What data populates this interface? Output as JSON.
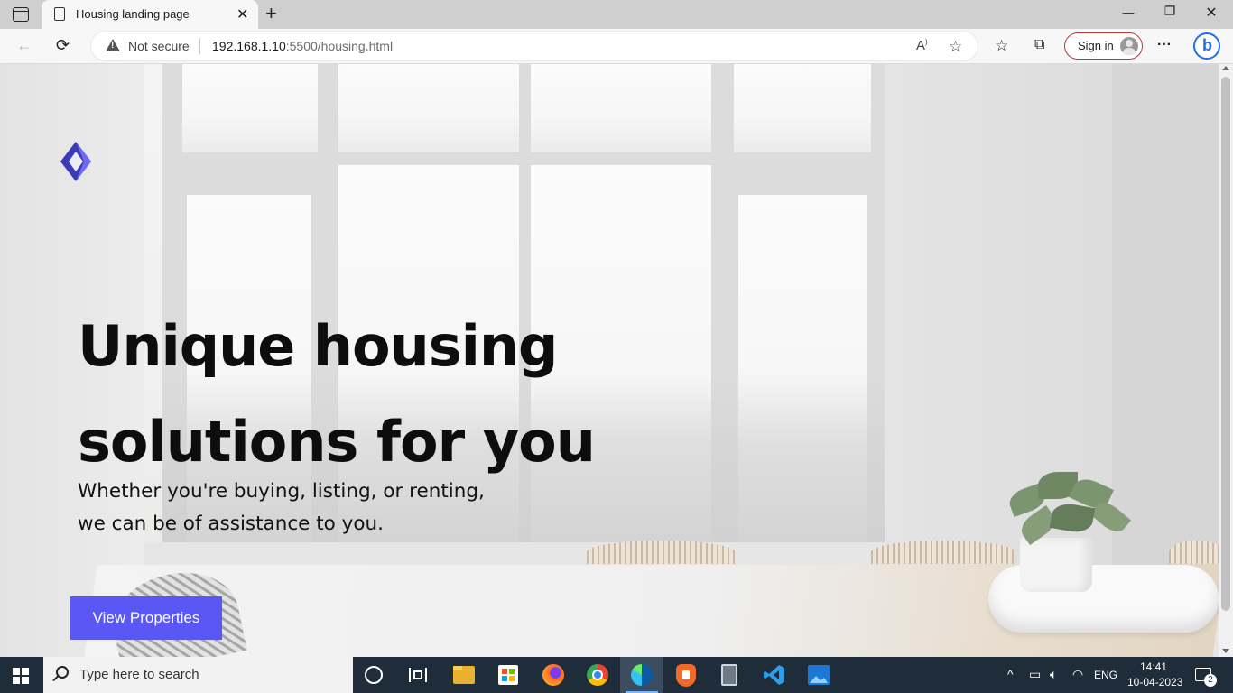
{
  "browser": {
    "tab_title": "Housing landing page",
    "tab_close": "✕",
    "new_tab": "+",
    "security_label": "Not secure",
    "url_host": "192.168.1.10",
    "url_rest": ":5500/housing.html",
    "sign_in_label": "Sign in",
    "more_label": "···",
    "bing_label": "b",
    "window_controls": {
      "minimize": "—",
      "maximize": "❐",
      "close": "✕"
    }
  },
  "page": {
    "hero_title_line1": "Unique housing",
    "hero_title_line2": "solutions for you",
    "hero_sub_line1": "Whether you're buying, listing, or renting,",
    "hero_sub_line2": "we can be of assistance to you.",
    "cta_label": "View Properties"
  },
  "taskbar": {
    "search_placeholder": "Type here to search",
    "language": "ENG",
    "time": "14:41",
    "date": "10-04-2023",
    "notifications": "2"
  },
  "colors": {
    "accent": "#5b57f5",
    "logo_dark": "#3b3ab8",
    "logo_light": "#6c6cf0",
    "taskbar": "#1f2d3b",
    "signin_border": "#b33a3a"
  },
  "icons": [
    "tab-actions-icon",
    "page-icon",
    "back-icon",
    "refresh-icon",
    "warning-icon",
    "read-aloud-icon",
    "add-favorite-icon",
    "favorites-icon",
    "collections-icon",
    "more-icon",
    "bing-icon",
    "windows-start-icon",
    "search-icon",
    "cortana-icon",
    "task-view-icon",
    "file-explorer-icon",
    "store-icon",
    "firefox-icon",
    "chrome-icon",
    "edge-icon",
    "brave-icon",
    "calculator-icon",
    "vscode-icon",
    "photos-icon",
    "chevron-up-icon",
    "battery-icon",
    "volume-icon",
    "wifi-icon",
    "notification-icon"
  ]
}
